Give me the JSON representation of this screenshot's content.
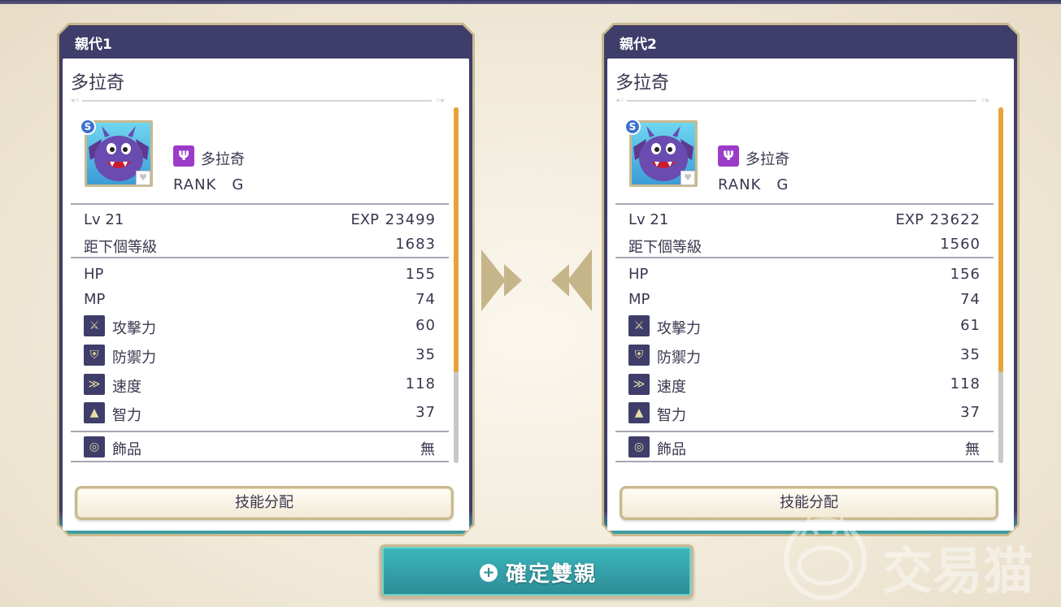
{
  "parents": [
    {
      "panel_title": "親代1",
      "monster_name": "多拉奇",
      "species_name": "多拉奇",
      "rank": "RANK　G",
      "badge": "S",
      "family_icon": "devil-family-icon",
      "lv": "Lv 21",
      "exp_label": "EXP",
      "exp_value": "23499",
      "to_next_label": "距下個等級",
      "to_next_value": "1683",
      "stats": {
        "hp_label": "HP",
        "hp_value": "155",
        "mp_label": "MP",
        "mp_value": "74",
        "atk_label": "攻擊力",
        "atk_value": "60",
        "def_label": "防禦力",
        "def_value": "35",
        "agi_label": "速度",
        "agi_value": "118",
        "int_label": "智力",
        "int_value": "37"
      },
      "accessory_label": "飾品",
      "accessory_value": "無",
      "skill_button": "技能分配"
    },
    {
      "panel_title": "親代2",
      "monster_name": "多拉奇",
      "species_name": "多拉奇",
      "rank": "RANK　G",
      "badge": "S",
      "family_icon": "devil-family-icon",
      "lv": "Lv 21",
      "exp_label": "EXP",
      "exp_value": "23622",
      "to_next_label": "距下個等級",
      "to_next_value": "1560",
      "stats": {
        "hp_label": "HP",
        "hp_value": "156",
        "mp_label": "MP",
        "mp_value": "74",
        "atk_label": "攻擊力",
        "atk_value": "61",
        "def_label": "防禦力",
        "def_value": "35",
        "agi_label": "速度",
        "agi_value": "118",
        "int_label": "智力",
        "int_value": "37"
      },
      "accessory_label": "飾品",
      "accessory_value": "無",
      "skill_button": "技能分配"
    }
  ],
  "confirm_button": "確定雙親",
  "watermark": "交易猫",
  "colors": {
    "panel_header": "#3f3d6a",
    "gold_frame": "#c9b98f",
    "teal_button": "#3bb7bc",
    "scroll_thumb": "#e6a33a",
    "family_purple": "#9b3bc9"
  }
}
